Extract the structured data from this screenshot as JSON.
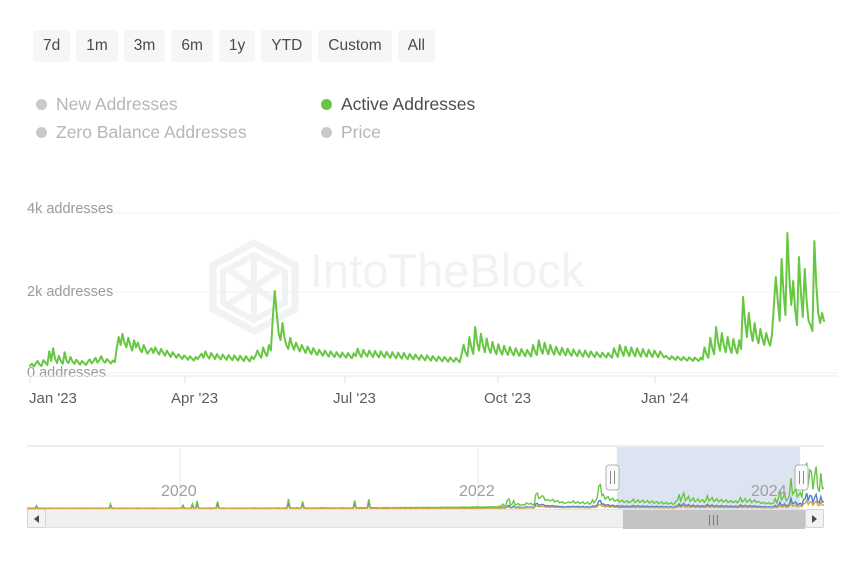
{
  "range_buttons": [
    {
      "label": "7d"
    },
    {
      "label": "1m"
    },
    {
      "label": "3m"
    },
    {
      "label": "6m"
    },
    {
      "label": "1y"
    },
    {
      "label": "YTD"
    },
    {
      "label": "Custom"
    },
    {
      "label": "All"
    }
  ],
  "legend": [
    {
      "label": "New Addresses",
      "active": false,
      "color": "#c9c9c9"
    },
    {
      "label": "Active Addresses",
      "active": true,
      "color": "#67c743"
    },
    {
      "label": "Zero Balance Addresses",
      "active": false,
      "color": "#c9c9c9"
    },
    {
      "label": "Price",
      "active": false,
      "color": "#c9c9c9"
    }
  ],
  "watermark": {
    "text": "IntoTheBlock",
    "logo": "hexagon-logo-icon"
  },
  "navigator": {
    "year_labels": [
      "2020",
      "2022",
      "2024"
    ],
    "selection_start_pct": 74,
    "selection_end_pct": 97,
    "scrollbar": {
      "left_arrow": "scroll-left-icon",
      "right_arrow": "scroll-right-icon",
      "thumb_grip": "|||"
    }
  },
  "chart_data": {
    "type": "line",
    "title": "Active Addresses",
    "xlabel": "",
    "ylabel": "addresses",
    "grid": true,
    "legend_position": "top-left",
    "ylim": [
      0,
      4000
    ],
    "ytick_labels": [
      "0 addresses",
      "2k addresses",
      "4k addresses"
    ],
    "yticks": [
      0,
      2000,
      4000
    ],
    "xtick_labels": [
      "Jan '23",
      "Apr '23",
      "Jul '23",
      "Oct '23",
      "Jan '24"
    ],
    "xticks": [
      "2023-01-01",
      "2023-04-01",
      "2023-07-01",
      "2023-10-01",
      "2024-01-01"
    ],
    "series": [
      {
        "name": "Active Addresses",
        "color": "#67c743",
        "values": [
          180,
          230,
          160,
          240,
          300,
          210,
          175,
          320,
          260,
          200,
          540,
          300,
          620,
          360,
          250,
          430,
          300,
          230,
          520,
          300,
          250,
          400,
          290,
          230,
          330,
          270,
          210,
          300,
          250,
          200,
          280,
          340,
          240,
          300,
          380,
          260,
          320,
          420,
          300,
          260,
          350,
          290,
          240,
          310,
          270,
          620,
          900,
          700,
          980,
          760,
          640,
          880,
          700,
          560,
          820,
          640,
          760,
          600,
          520,
          700,
          580,
          480,
          560,
          620,
          500,
          640,
          540,
          460,
          600,
          520,
          430,
          560,
          480,
          400,
          520,
          450,
          380,
          470,
          410,
          350,
          440,
          390,
          330,
          420,
          360,
          310,
          400,
          350,
          420,
          480,
          380,
          540,
          430,
          360,
          500,
          420,
          350,
          470,
          400,
          340,
          460,
          390,
          330,
          450,
          380,
          320,
          440,
          370,
          310,
          430,
          360,
          300,
          420,
          350,
          290,
          410,
          350,
          420,
          560,
          460,
          380,
          640,
          500,
          420,
          700,
          560,
          1400,
          2050,
          1500,
          1000,
          820,
          1250,
          900,
          700,
          600,
          880,
          700,
          580,
          760,
          640,
          540,
          700,
          600,
          500,
          660,
          560,
          470,
          620,
          530,
          450,
          580,
          500,
          430,
          560,
          480,
          410,
          540,
          460,
          400,
          520,
          450,
          390,
          510,
          440,
          380,
          500,
          430,
          370,
          490,
          420,
          610,
          470,
          400,
          580,
          480,
          410,
          560,
          470,
          400,
          550,
          460,
          390,
          540,
          450,
          390,
          530,
          440,
          380,
          520,
          430,
          370,
          510,
          420,
          360,
          500,
          410,
          350,
          480,
          400,
          340,
          460,
          390,
          330,
          450,
          380,
          320,
          440,
          370,
          310,
          420,
          360,
          300,
          410,
          350,
          290,
          400,
          340,
          280,
          390,
          330,
          280,
          380,
          320,
          270,
          480,
          700,
          520,
          420,
          900,
          640,
          480,
          1150,
          760,
          560,
          980,
          700,
          520,
          860,
          620,
          500,
          780,
          580,
          470,
          720,
          560,
          460,
          680,
          540,
          450,
          650,
          520,
          440,
          620,
          510,
          430,
          600,
          500,
          420,
          580,
          490,
          410,
          700,
          540,
          450,
          820,
          600,
          480,
          760,
          580,
          470,
          700,
          550,
          460,
          660,
          530,
          450,
          630,
          520,
          440,
          610,
          500,
          430,
          590,
          490,
          420,
          570,
          480,
          410,
          560,
          470,
          400,
          540,
          460,
          395,
          520,
          450,
          390,
          510,
          440,
          385,
          500,
          430,
          380,
          620,
          490,
          400,
          700,
          540,
          430,
          660,
          520,
          420,
          640,
          510,
          415,
          620,
          500,
          410,
          600,
          490,
          405,
          580,
          480,
          400,
          560,
          470,
          395,
          540,
          460,
          390,
          430,
          380,
          340,
          420,
          370,
          330,
          410,
          360,
          320,
          400,
          350,
          310,
          390,
          345,
          305,
          385,
          340,
          300,
          380,
          335,
          640,
          480,
          380,
          880,
          620,
          470,
          1150,
          780,
          560,
          1000,
          700,
          520,
          900,
          640,
          500,
          850,
          620,
          490,
          820,
          600,
          1900,
          1300,
          900,
          1500,
          1050,
          800,
          1250,
          920,
          740,
          1100,
          860,
          700,
          1000,
          820,
          680,
          950,
          1700,
          2400,
          1800,
          1300,
          2850,
          2000,
          1450,
          3500,
          2400,
          1700,
          2300,
          1600,
          1200,
          2900,
          2000,
          1400,
          2600,
          1800,
          1300,
          1200,
          1050,
          3300,
          2200,
          1500,
          1250,
          1500,
          1300
        ]
      }
    ],
    "navigator_series": [
      {
        "name": "Active Addresses",
        "color": "#67c743"
      },
      {
        "name": "New Addresses",
        "color": "#4f7fd0"
      },
      {
        "name": "Zero Balance Addresses",
        "color": "#d4a544"
      }
    ]
  }
}
